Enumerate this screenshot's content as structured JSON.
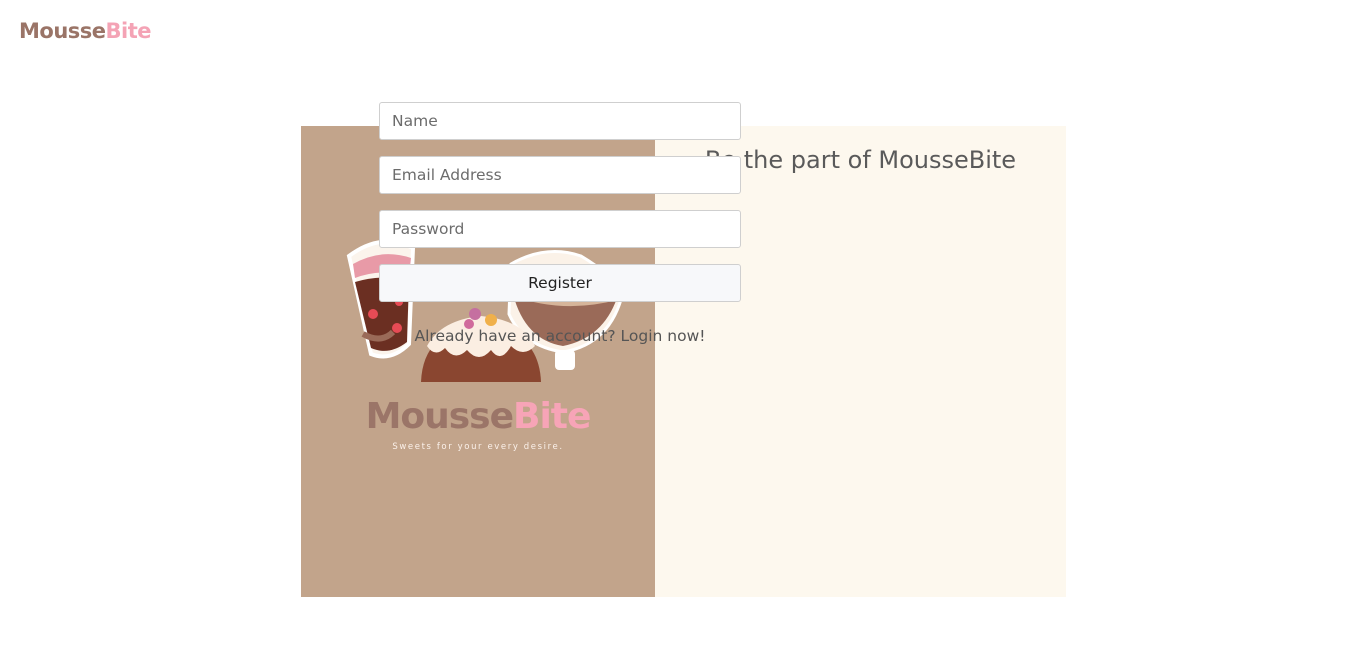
{
  "nav": {
    "logo_part_a": "Mousse",
    "logo_part_b": "Bite"
  },
  "hero": {
    "brand_part_a": "Mousse",
    "brand_part_b": "Bite",
    "tagline": "Sweets for your every desire."
  },
  "form": {
    "title": "Be the part of MousseBite",
    "name_placeholder": "Name",
    "email_placeholder": "Email Address",
    "password_placeholder": "Password",
    "register_label": "Register",
    "login_prompt": "Already have an account?",
    "login_link": "Login now!"
  },
  "colors": {
    "brand_brown": "#9a7467",
    "brand_pink": "#f4a3b5",
    "left_panel_bg": "#c2a48b",
    "right_panel_bg": "#fdf8ee"
  }
}
